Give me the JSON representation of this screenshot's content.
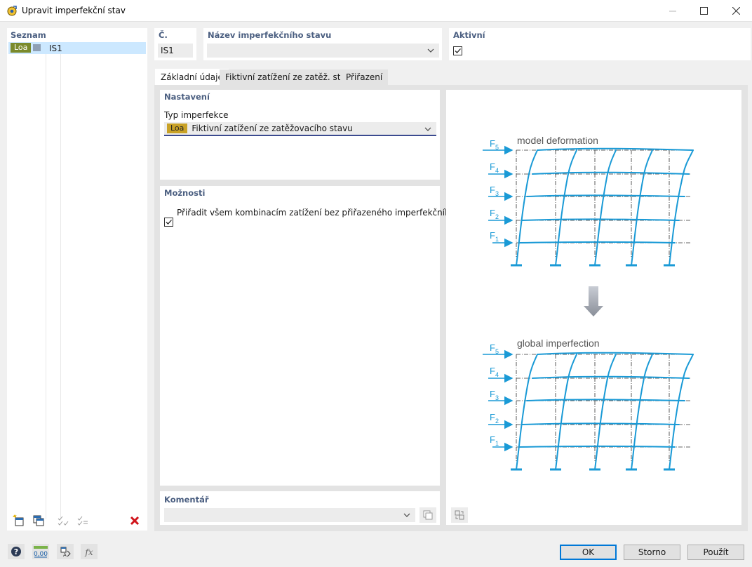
{
  "window": {
    "title": "Upravit imperfekční stav"
  },
  "list": {
    "header": "Seznam",
    "items": [
      {
        "badge": "Loa",
        "label": "IS1"
      }
    ]
  },
  "number": {
    "label": "Č.",
    "value": "IS1"
  },
  "name": {
    "label": "Název imperfekčního stavu",
    "value": ""
  },
  "active": {
    "label": "Aktivní",
    "checked": true
  },
  "tabs": [
    {
      "label": "Základní údaje",
      "active": true
    },
    {
      "label": "Fiktivní zatížení ze zatěž. stavu",
      "active": false
    },
    {
      "label": "Přiřazení",
      "active": false
    }
  ],
  "settings": {
    "header": "Nastavení",
    "type_label": "Typ imperfekce",
    "type_badge": "Loa",
    "type_value": "Fiktivní zatížení ze zatěžovacího stavu"
  },
  "options": {
    "header": "Možnosti",
    "assign_all_label": "Přiřadit všem kombinacím zatížení bez přiřazeného imperfekčního stavu",
    "assign_all_checked": true
  },
  "comment": {
    "header": "Komentář",
    "value": ""
  },
  "figure": {
    "top_title": "model deformation",
    "bottom_title": "global imperfection",
    "forces": [
      {
        "letter": "F",
        "sub": "5"
      },
      {
        "letter": "F",
        "sub": "4"
      },
      {
        "letter": "F",
        "sub": "3"
      },
      {
        "letter": "F",
        "sub": "2"
      },
      {
        "letter": "F",
        "sub": "1"
      }
    ]
  },
  "footer": {
    "ok": "OK",
    "cancel": "Storno",
    "apply": "Použít",
    "units_value": "0,00"
  },
  "colors": {
    "accent_blue": "#1a9ad6",
    "badge_olive": "#7a8a2c",
    "badge_gold": "#c9a227",
    "section_label": "#4a5e80",
    "delete_red": "#d0141b"
  }
}
